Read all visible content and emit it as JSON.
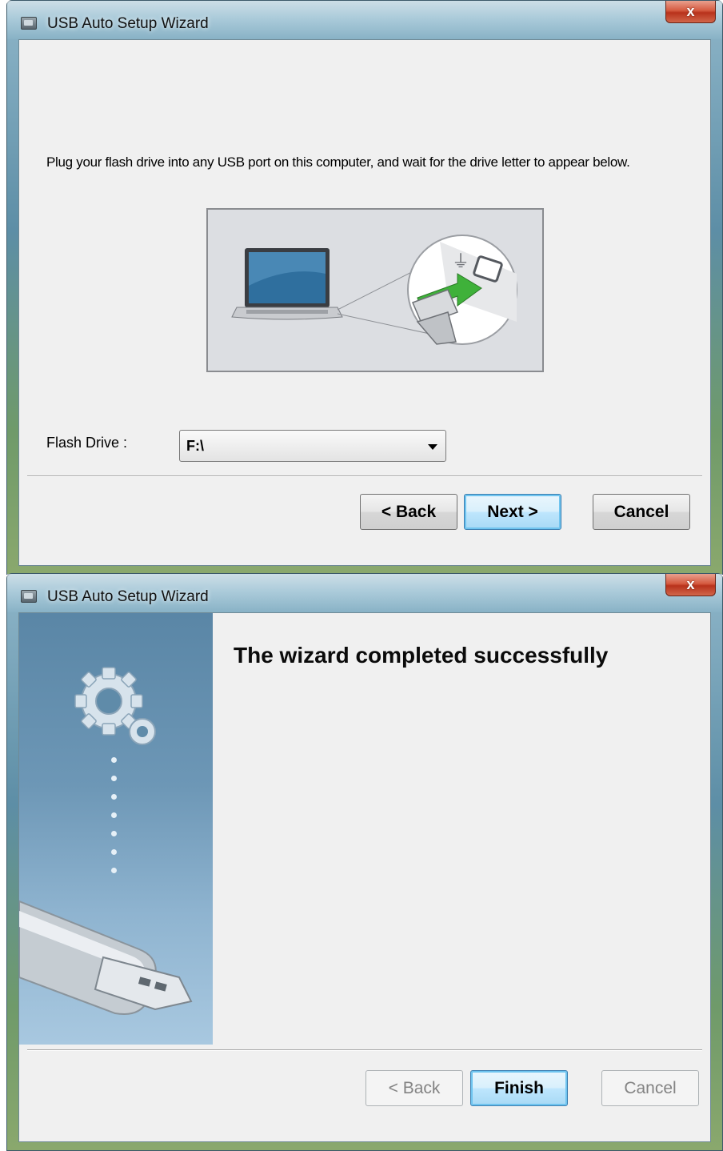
{
  "window_title": "USB Auto Setup Wizard",
  "close_label": "x",
  "step1": {
    "instruction": "Plug your flash drive into any USB port on this computer, and wait for the drive letter to appear below.",
    "flash_drive_label": "Flash Drive :",
    "flash_drive_value": "F:\\",
    "buttons": {
      "back": "< Back",
      "next": "Next >",
      "cancel": "Cancel"
    }
  },
  "step2": {
    "heading": "The wizard completed successfully",
    "buttons": {
      "back": "< Back",
      "finish": "Finish",
      "cancel": "Cancel"
    }
  },
  "colors": {
    "accent": "#3c7fb1",
    "dialog_bg": "#f0f0f0",
    "side_panel": "#6d97b6",
    "arrow_green": "#3fb13a"
  },
  "icons": [
    "app-icon",
    "close-icon",
    "laptop-icon",
    "usb-icon",
    "arrow-icon",
    "gear-icon",
    "usb-drive-icon",
    "dropdown-arrow-icon"
  ]
}
